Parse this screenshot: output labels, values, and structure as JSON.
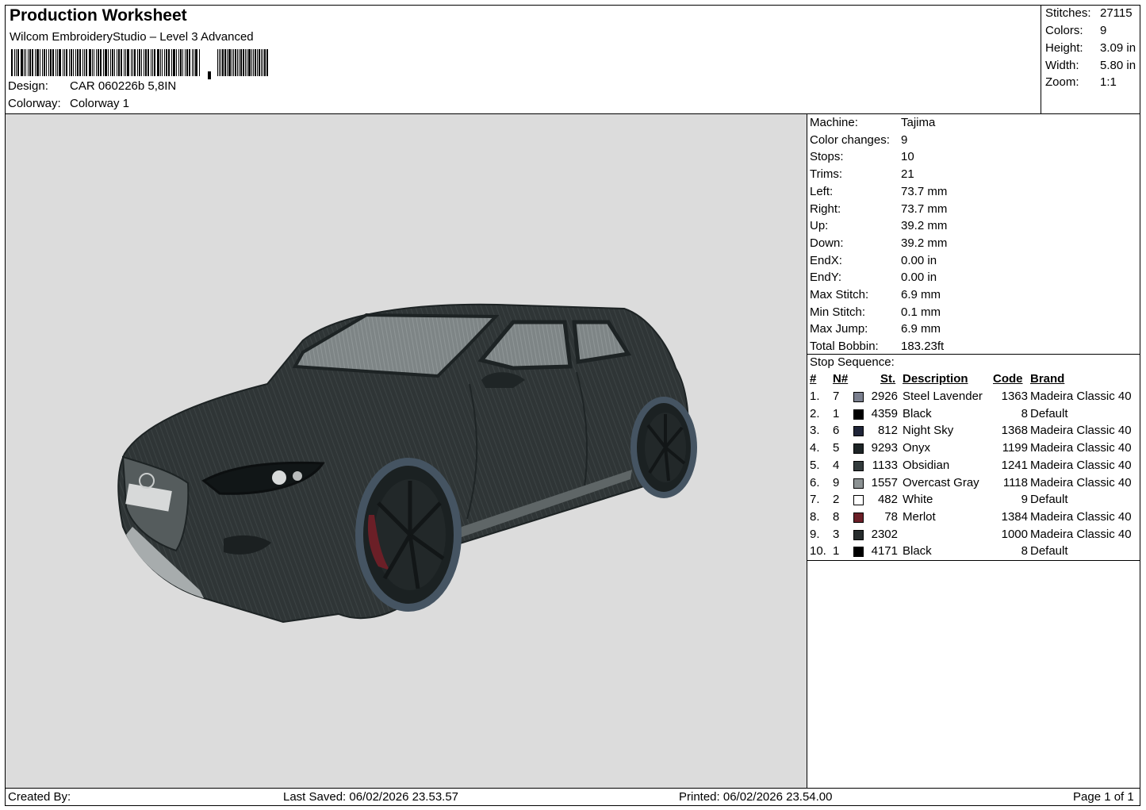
{
  "header": {
    "title": "Production Worksheet",
    "software": "Wilcom EmbroideryStudio – Level 3 Advanced",
    "design_label": "Design:",
    "design_value": "CAR 060226b 5,8IN",
    "colorway_label": "Colorway:",
    "colorway_value": "Colorway 1"
  },
  "summary": {
    "stitches_label": "Stitches:",
    "stitches": "27115",
    "colors_label": "Colors:",
    "colors": "9",
    "height_label": "Height:",
    "height": "3.09 in",
    "width_label": "Width:",
    "width": "5.80 in",
    "zoom_label": "Zoom:",
    "zoom": "1:1"
  },
  "stats": [
    {
      "label": "Machine:",
      "value": "Tajima"
    },
    {
      "label": "Color changes:",
      "value": "9"
    },
    {
      "label": "Stops:",
      "value": "10"
    },
    {
      "label": "Trims:",
      "value": "21"
    },
    {
      "label": "Left:",
      "value": "73.7 mm"
    },
    {
      "label": "Right:",
      "value": "73.7 mm"
    },
    {
      "label": "Up:",
      "value": "39.2 mm"
    },
    {
      "label": "Down:",
      "value": "39.2 mm"
    },
    {
      "label": "EndX:",
      "value": "0.00 in"
    },
    {
      "label": "EndY:",
      "value": "0.00 in"
    },
    {
      "label": "Max Stitch:",
      "value": "6.9 mm"
    },
    {
      "label": "Min Stitch:",
      "value": "0.1 mm"
    },
    {
      "label": "Max Jump:",
      "value": "6.9 mm"
    },
    {
      "label": "Total Bobbin:",
      "value": "183.23ft"
    }
  ],
  "stop_sequence": {
    "caption": "Stop Sequence:",
    "headers": {
      "index": "#",
      "needle": "N#",
      "st": "St.",
      "description": "Description",
      "code": "Code",
      "brand": "Brand"
    },
    "rows": [
      {
        "index": "1.",
        "needle": "7",
        "color": "#7a7f8e",
        "st": "2926",
        "description": "Steel Lavender",
        "code": "1363",
        "brand": "Madeira Classic 40"
      },
      {
        "index": "2.",
        "needle": "1",
        "color": "#000000",
        "st": "4359",
        "description": "Black",
        "code": "8",
        "brand": "Default"
      },
      {
        "index": "3.",
        "needle": "6",
        "color": "#1f2538",
        "st": "812",
        "description": "Night Sky",
        "code": "1368",
        "brand": "Madeira Classic 40"
      },
      {
        "index": "4.",
        "needle": "5",
        "color": "#1d2426",
        "st": "9293",
        "description": "Onyx",
        "code": "1199",
        "brand": "Madeira Classic 40"
      },
      {
        "index": "5.",
        "needle": "4",
        "color": "#333b3c",
        "st": "1133",
        "description": "Obsidian",
        "code": "1241",
        "brand": "Madeira Classic 40"
      },
      {
        "index": "6.",
        "needle": "9",
        "color": "#8c9293",
        "st": "1557",
        "description": "Overcast Gray",
        "code": "1118",
        "brand": "Madeira Classic 40"
      },
      {
        "index": "7.",
        "needle": "2",
        "color": "#ffffff",
        "st": "482",
        "description": "White",
        "code": "9",
        "brand": "Default"
      },
      {
        "index": "8.",
        "needle": "8",
        "color": "#6b1f27",
        "st": "78",
        "description": "Merlot",
        "code": "1384",
        "brand": "Madeira Classic 40"
      },
      {
        "index": "9.",
        "needle": "3",
        "color": "#262b2c",
        "st": "2302",
        "description": "",
        "code": "1000",
        "brand": "Madeira Classic 40"
      },
      {
        "index": "10.",
        "needle": "1",
        "color": "#000000",
        "st": "4171",
        "description": "Black",
        "code": "8",
        "brand": "Default"
      }
    ]
  },
  "footer": {
    "created_by": "Created By:",
    "last_saved": "Last Saved: 06/02/2026 23.53.57",
    "printed": "Printed: 06/02/2026 23.54.00",
    "page": "Page 1 of 1"
  }
}
